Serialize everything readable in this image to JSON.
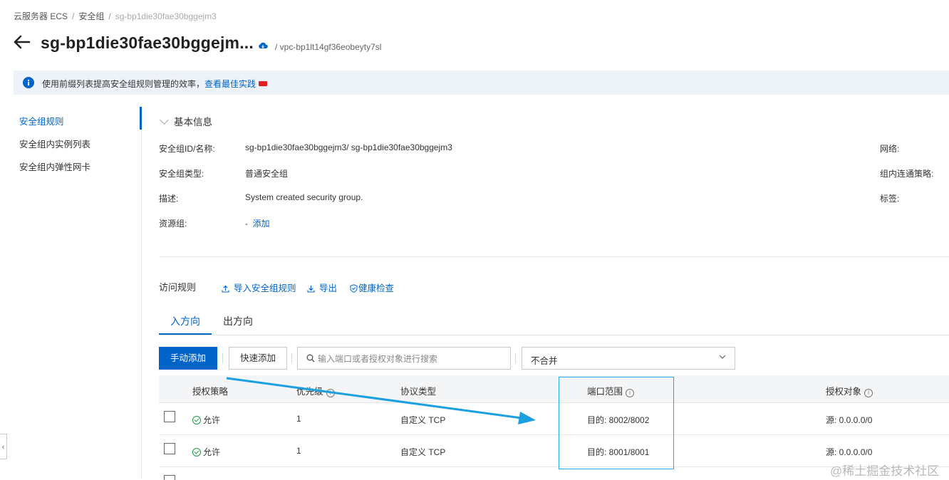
{
  "breadcrumb": [
    "云服务器 ECS",
    "安全组",
    "sg-bp1die30fae30bggejm3"
  ],
  "header": {
    "title": "sg-bp1die30fae30bggejm...",
    "vpc": "/ vpc-bp1lt14gf36eobeyty7sl"
  },
  "notice": {
    "text": "使用前缀列表提高安全组规则管理的效率，",
    "link": "查看最佳实践"
  },
  "sidebar": {
    "items": [
      {
        "label": "安全组规则",
        "active": true
      },
      {
        "label": "安全组内实例列表",
        "active": false
      },
      {
        "label": "安全组内弹性网卡",
        "active": false
      }
    ]
  },
  "basic_info": {
    "title": "基本信息",
    "fields": [
      {
        "label": "安全组ID/名称:",
        "value": "sg-bp1die30fae30bggejm3/ sg-bp1die30fae30bggejm3"
      },
      {
        "label": "安全组类型:",
        "value": "普通安全组"
      },
      {
        "label": "描述:",
        "value": "System created security group."
      },
      {
        "label": "资源组:",
        "value": "-",
        "action": "添加"
      }
    ],
    "right_labels": [
      "网络:",
      "组内连通策略:",
      "标签:"
    ]
  },
  "rules": {
    "title": "访问规则",
    "import_label": "导入安全组规则",
    "export_label": "导出",
    "health_label": "健康检查",
    "tabs": [
      "入方向",
      "出方向"
    ],
    "add_button": "手动添加",
    "quick_add_button": "快速添加",
    "search_placeholder": "输入端口或者授权对象进行搜索",
    "merge_select": "不合并",
    "columns": [
      "授权策略",
      "优先级",
      "协议类型",
      "端口范围",
      "授权对象"
    ],
    "rows": [
      {
        "policy": "允许",
        "priority": "1",
        "protocol": "自定义 TCP",
        "port": "目的: 8002/8002",
        "source": "源: 0.0.0.0/0"
      },
      {
        "policy": "允许",
        "priority": "1",
        "protocol": "自定义 TCP",
        "port": "目的: 8001/8001",
        "source": "源: 0.0.0.0/0"
      }
    ]
  },
  "watermark": "@稀土掘金技术社区",
  "colors": {
    "accent": "#0064c8",
    "allow": "#1e9c4a",
    "annotation": "#1aa0e0"
  }
}
